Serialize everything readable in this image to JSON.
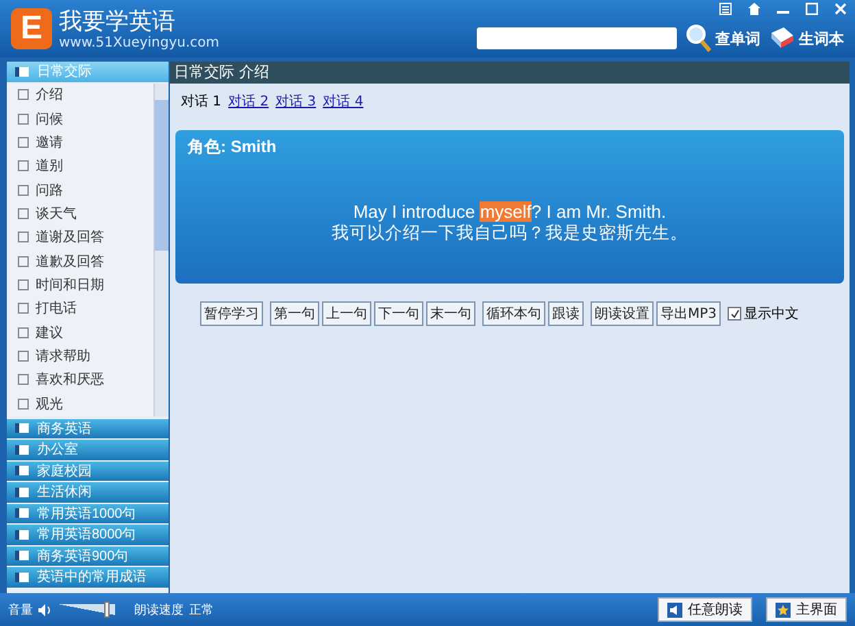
{
  "header": {
    "logo_letter": "E",
    "title": "我要学英语",
    "url": "www.51Xueyingyu.com",
    "lookup_button": "查单词",
    "wordbook_button": "生词本"
  },
  "sidebar": {
    "categories": [
      {
        "label": "日常交际",
        "expanded": true,
        "children": [
          "介绍",
          "问候",
          "邀请",
          "道别",
          "问路",
          "谈天气",
          "道谢及回答",
          "道歉及回答",
          "时间和日期",
          "打电话",
          "建议",
          "请求帮助",
          "喜欢和厌恶",
          "观光"
        ]
      },
      {
        "label": "商务英语",
        "expanded": false
      },
      {
        "label": "办公室",
        "expanded": false
      },
      {
        "label": "家庭校园",
        "expanded": false
      },
      {
        "label": "生活休闲",
        "expanded": false
      },
      {
        "label": "常用英语1000句",
        "expanded": false
      },
      {
        "label": "常用英语8000句",
        "expanded": false
      },
      {
        "label": "商务英语900句",
        "expanded": false
      },
      {
        "label": "英语中的常用成语",
        "expanded": false
      }
    ]
  },
  "content": {
    "breadcrumb": "日常交际 介绍",
    "tabs": [
      {
        "label": "对话 1",
        "selected": true
      },
      {
        "label": "对话 2",
        "selected": false
      },
      {
        "label": "对话 3",
        "selected": false
      },
      {
        "label": "对话 4",
        "selected": false
      }
    ],
    "card": {
      "role": "角色: Smith",
      "sentence": [
        {
          "text": "May I introduce ",
          "highlighted": false
        },
        {
          "text": "myself",
          "highlighted": true
        },
        {
          "text": "? I am Mr. Smith.",
          "highlighted": false
        }
      ],
      "translation": "我可以介绍一下我自己吗？我是史密斯先生。"
    },
    "button_groups": [
      [
        "暂停学习"
      ],
      [
        "第一句",
        "上一句",
        "下一句",
        "末一句"
      ],
      [
        "循环本句",
        "跟读"
      ],
      [
        "朗读设置",
        "导出MP3"
      ]
    ],
    "show_chinese": {
      "label": "显示中文",
      "checked": true
    }
  },
  "status_bar": {
    "volume_label": "音量",
    "volume": {
      "level": 0.9
    },
    "speed_label": "朗读速度",
    "speed_value": "正常",
    "buttons": [
      {
        "kind": "speaker",
        "label": "任意朗读"
      },
      {
        "kind": "star",
        "label": "主界面"
      }
    ]
  }
}
